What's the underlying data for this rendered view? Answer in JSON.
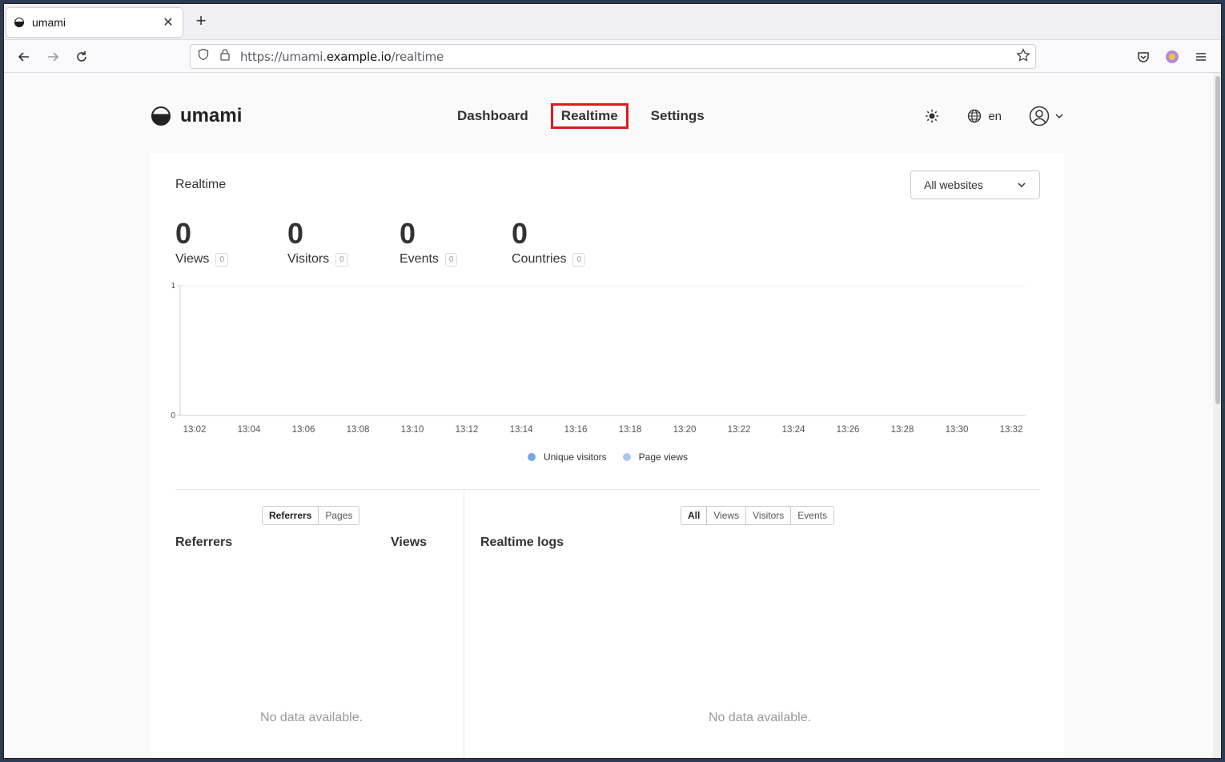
{
  "browser": {
    "tab_title": "umami",
    "url_prefix": "https://umami.",
    "url_domain": "example.io",
    "url_path": "/realtime"
  },
  "app": {
    "brand": "umami",
    "nav": [
      "Dashboard",
      "Realtime",
      "Settings"
    ],
    "active_nav": "Realtime",
    "language": "en"
  },
  "realtime": {
    "title": "Realtime",
    "website_select": "All websites",
    "metrics": [
      {
        "value": "0",
        "label": "Views",
        "badge": "0"
      },
      {
        "value": "0",
        "label": "Visitors",
        "badge": "0"
      },
      {
        "value": "0",
        "label": "Events",
        "badge": "0"
      },
      {
        "value": "0",
        "label": "Countries",
        "badge": "0"
      }
    ]
  },
  "chart_data": {
    "type": "bar",
    "categories": [
      "13:02",
      "13:04",
      "13:06",
      "13:08",
      "13:10",
      "13:12",
      "13:14",
      "13:16",
      "13:18",
      "13:20",
      "13:22",
      "13:24",
      "13:26",
      "13:28",
      "13:30",
      "13:32"
    ],
    "series": [
      {
        "name": "Unique visitors",
        "color": "#76a7e6",
        "values": [
          0,
          0,
          0,
          0,
          0,
          0,
          0,
          0,
          0,
          0,
          0,
          0,
          0,
          0,
          0,
          0
        ]
      },
      {
        "name": "Page views",
        "color": "#a9c9f0",
        "values": [
          0,
          0,
          0,
          0,
          0,
          0,
          0,
          0,
          0,
          0,
          0,
          0,
          0,
          0,
          0,
          0
        ]
      }
    ],
    "y_ticks": [
      "1",
      "0"
    ],
    "ylim": [
      0,
      1
    ]
  },
  "referrers": {
    "tabs": [
      "Referrers",
      "Pages"
    ],
    "active_tab": "Referrers",
    "title": "Referrers",
    "column": "Views",
    "empty": "No data available."
  },
  "logs": {
    "tabs": [
      "All",
      "Views",
      "Visitors",
      "Events"
    ],
    "active_tab": "All",
    "title": "Realtime logs",
    "empty": "No data available."
  }
}
